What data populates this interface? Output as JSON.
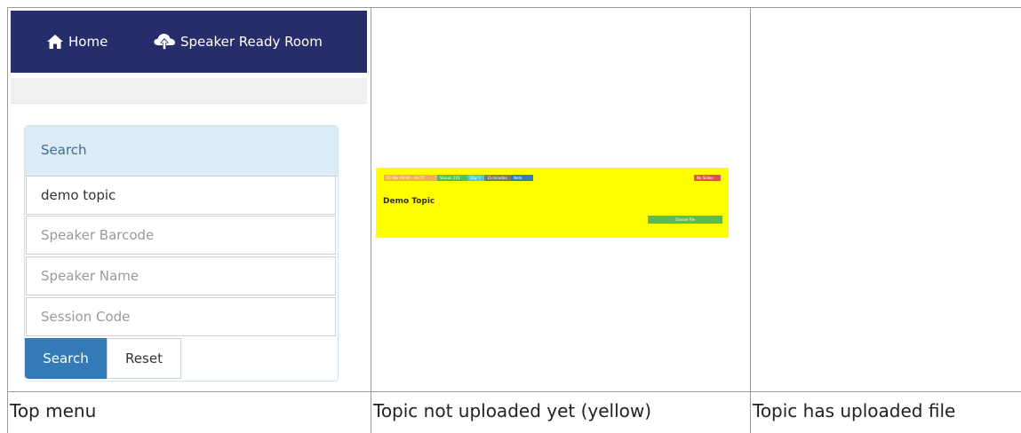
{
  "top_menu_preview": {
    "nav": {
      "home_label": "Home",
      "speaker_ready_room_label": "Speaker Ready Room"
    },
    "search_panel": {
      "title": "Search",
      "topic_value": "demo topic",
      "speaker_barcode_placeholder": "Speaker Barcode",
      "speaker_name_placeholder": "Speaker Name",
      "session_code_placeholder": "Session Code",
      "search_button": "Search",
      "reset_button": "Reset"
    },
    "colors": {
      "navbar": "#272d6b",
      "panel_heading": "#dbecf6",
      "primary": "#337ab7"
    }
  },
  "topic_card_preview": {
    "title": "Demo Topic",
    "tags": [
      "01 Mar 09:00 - 09:15",
      "Venue: 101",
      "Day 1",
      "15 minutes",
      "Note"
    ],
    "status_badge": "No Slides",
    "choose_file_button": "Choose File",
    "colors": {
      "background": "#ffff00",
      "badge": "#d9534f",
      "button": "#5cb85c"
    }
  },
  "captions": {
    "col1": "Top menu",
    "col2": "Topic not uploaded yet (yellow)",
    "col3": "Topic has uploaded file"
  }
}
